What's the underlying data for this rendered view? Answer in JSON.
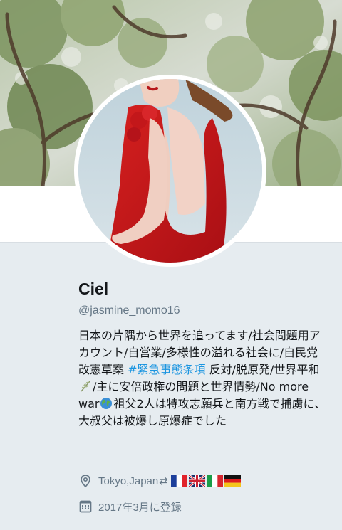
{
  "profile": {
    "display_name": "Ciel",
    "screen_name": "@jasmine_momo16",
    "bio": {
      "part1": "日本の片隅から世界を追ってます/社会問題用アカウント/自営業/多様性の溢れる社会に/自民党改憲草案 ",
      "hashtag": "#緊急事態条項",
      "part2": " 反対/脱原発/世界平和",
      "part3": "/主に安倍政権の問題と世界情勢/No more war",
      "part4": "祖父2人は特攻志願兵と南方戦で捕虜に、大叔父は被爆し原爆症でした"
    },
    "location": "Tokyo,Japan",
    "location_arrows": "⇄",
    "joined": "2017年3月に登録"
  },
  "icons": {
    "location": "map-pin-icon",
    "joined": "calendar-icon",
    "peace": "olive-branch-icon",
    "globe": "globe-icon",
    "flags": [
      "france-flag-icon",
      "uk-flag-icon",
      "italy-flag-icon",
      "germany-flag-icon"
    ]
  },
  "colors": {
    "hashtag": "#1b95e0",
    "secondary_text": "#657786",
    "primary_text": "#14171a",
    "page_background": "#e6ecf0"
  }
}
